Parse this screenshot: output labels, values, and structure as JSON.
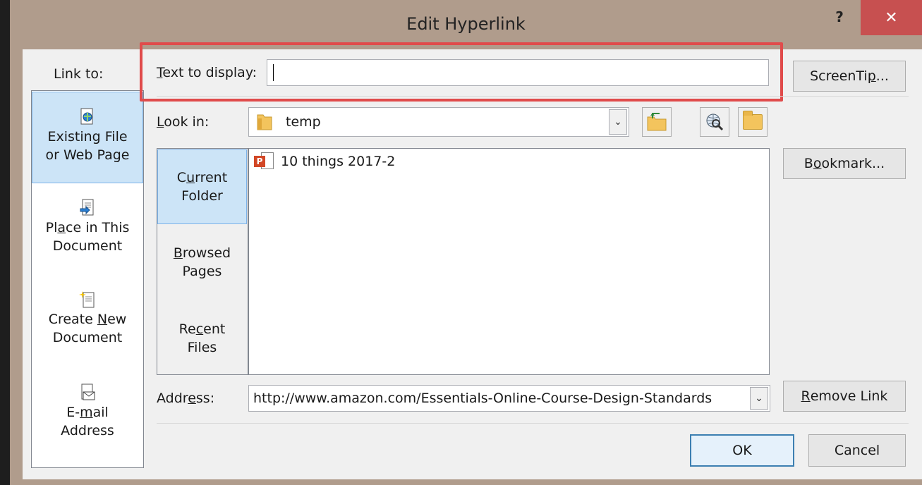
{
  "window": {
    "title": "Edit Hyperlink",
    "help_label": "?",
    "close_label": "✕"
  },
  "link_to": {
    "label": "Link to:",
    "items": [
      {
        "line1": "Existing File",
        "line2": "or Web Page",
        "selected": true
      },
      {
        "line1": "Place in This",
        "line2": "Document"
      },
      {
        "line1": "Create New",
        "line2": "Document"
      },
      {
        "line1": "E-mail",
        "line2": "Address"
      }
    ]
  },
  "text_to_display": {
    "label": "Text to display:",
    "value": ""
  },
  "screentip_button": "ScreenTip...",
  "look_in": {
    "label": "Look in:",
    "value": "temp",
    "arrow": "⌄"
  },
  "nav": {
    "current_folder": {
      "line1": "Current",
      "line2": "Folder"
    },
    "browsed_pages": {
      "line1": "Browsed",
      "line2": "Pages"
    },
    "recent_files": {
      "line1": "Recent",
      "line2": "Files"
    }
  },
  "files": [
    {
      "name": "10 things 2017-2",
      "icon": "powerpoint-icon"
    }
  ],
  "bookmark_button": "Bookmark...",
  "address": {
    "label": "Address:",
    "value": "http://www.amazon.com/Essentials-Online-Course-Design-Standards",
    "arrow": "⌄"
  },
  "remove_link_button": "Remove Link",
  "ok_button": "OK",
  "cancel_button": "Cancel",
  "colors": {
    "selected_bg": "#cce4f7",
    "close_red": "#c75050",
    "highlight_red": "#e04b4b"
  }
}
